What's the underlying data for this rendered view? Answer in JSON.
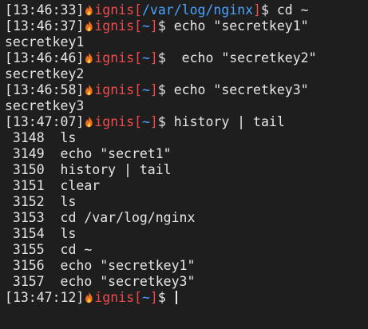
{
  "colors": {
    "background": "#1e1e1e",
    "text": "#e6e6e6",
    "user": "#ef4b4b",
    "directory": "#4aa3ff"
  },
  "icon": "fire-icon",
  "prompts": [
    {
      "time": "13:46:33",
      "user": "ignis",
      "dir": "/var/log/nginx",
      "command": " cd ~"
    },
    {
      "time": "13:46:37",
      "user": "ignis",
      "dir": "~",
      "command": " echo \"secretkey1\""
    },
    {
      "time": "13:46:46",
      "user": "ignis",
      "dir": "~",
      "command": "  echo \"secretkey2\""
    },
    {
      "time": "13:46:58",
      "user": "ignis",
      "dir": "~",
      "command": " echo \"secretkey3\""
    },
    {
      "time": "13:47:07",
      "user": "ignis",
      "dir": "~",
      "command": " history | tail"
    },
    {
      "time": "13:47:12",
      "user": "ignis",
      "dir": "~",
      "command": " "
    }
  ],
  "outputs": [
    "secretkey1",
    "secretkey2",
    "secretkey3"
  ],
  "history": [
    " 3148  ls",
    " 3149  echo \"secret1\"",
    " 3150  history | tail",
    " 3151  clear",
    " 3152  ls",
    " 3153  cd /var/log/nginx",
    " 3154  ls",
    " 3155  cd ~",
    " 3156  echo \"secretkey1\"",
    " 3157  echo \"secretkey3\""
  ]
}
